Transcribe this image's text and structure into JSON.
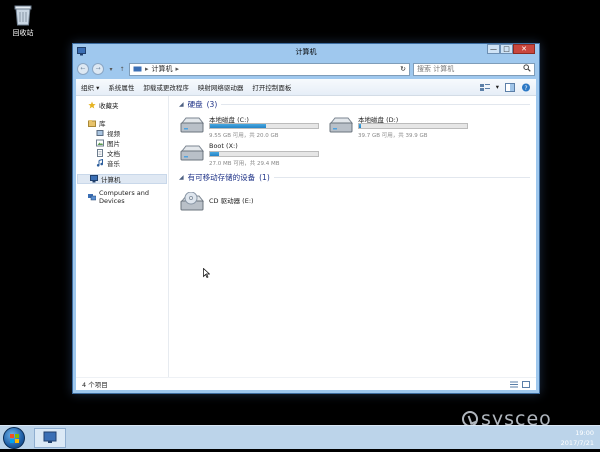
{
  "desktop": {
    "recycle_bin_label": "回收站"
  },
  "window": {
    "title": "计算机",
    "controls": {
      "minimize": "—",
      "maximize": "□",
      "close": "✕"
    },
    "address": {
      "crumb_arrow": "▸",
      "location": "计算机",
      "after_arrow": "▸",
      "refresh": "↻"
    },
    "nav_back": "←",
    "nav_forward": "→",
    "nav_history": "▾",
    "nav_up": "↑",
    "search": {
      "placeholder": "搜索 计算机",
      "icon": "search-icon"
    },
    "toolbar": {
      "organize": "组织 ▾",
      "system_properties": "系统属性",
      "uninstall": "卸载或更改程序",
      "map_drive": "映射网络驱动器",
      "control_panel": "打开控制面板",
      "view_dropdown": "▾"
    },
    "sidebar": {
      "favorites": "收藏夹",
      "libraries": "库",
      "videos": "视频",
      "pictures": "图片",
      "documents": "文档",
      "music": "音乐",
      "computer": "计算机",
      "computers_devices": "Computers and Devices"
    },
    "groups": {
      "hard_disks": {
        "label": "硬盘",
        "count": "(3)"
      },
      "removable": {
        "label": "有可移动存储的设备",
        "count": "(1)"
      }
    },
    "drives": [
      {
        "name": "本地磁盘 (C:)",
        "info": "9.55 GB 可用，共 20.0 GB",
        "used_fraction": 0.52
      },
      {
        "name": "本地磁盘 (D:)",
        "info": "39.7 GB 可用，共 39.9 GB",
        "used_fraction": 0.01
      },
      {
        "name": "Boot (X:)",
        "info": "27.0 MB 可用，共 29.4 MB",
        "used_fraction": 0.08
      }
    ],
    "cd_drive": {
      "name": "CD 驱动器 (E:)"
    },
    "status": {
      "item_count": "4 个项目"
    }
  },
  "taskbar": {
    "time": "19:00",
    "date": "2017/7/21"
  },
  "watermark": {
    "text": "sysceo"
  },
  "colors": {
    "drive_bar": "#2383c6",
    "close_button": "#c9463d",
    "group_header": "#1e3287"
  }
}
